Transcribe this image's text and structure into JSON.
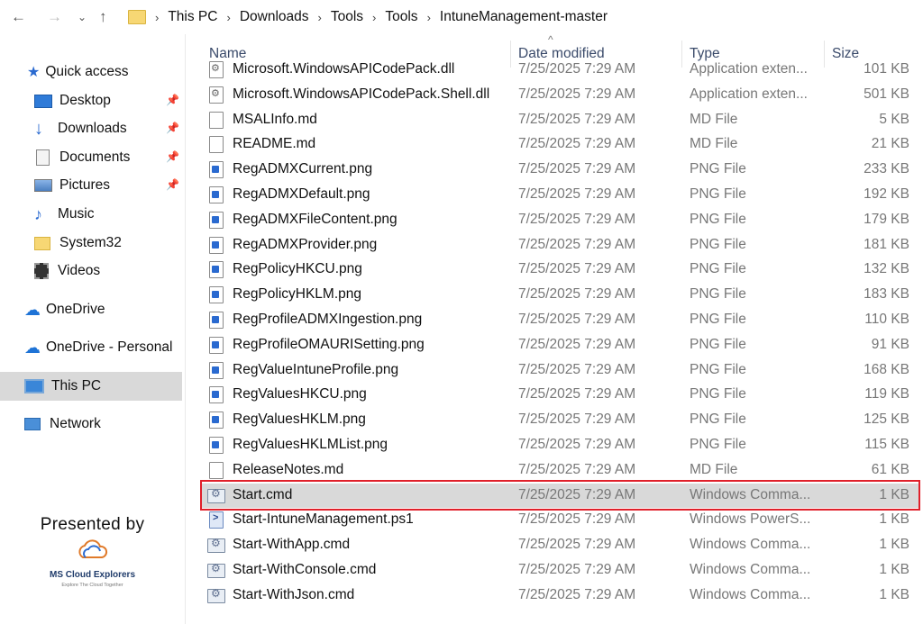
{
  "address_bar": {
    "crumbs": [
      "This PC",
      "Downloads",
      "Tools",
      "Tools",
      "IntuneManagement-master"
    ]
  },
  "sidebar": {
    "quick_access": "Quick access",
    "items": [
      {
        "label": "Desktop",
        "icon": "desktop-icon",
        "pinned": true
      },
      {
        "label": "Downloads",
        "icon": "download-arrow-icon",
        "pinned": true
      },
      {
        "label": "Documents",
        "icon": "document-icon",
        "pinned": true
      },
      {
        "label": "Pictures",
        "icon": "pictures-icon",
        "pinned": true
      },
      {
        "label": "Music",
        "icon": "music-note-icon",
        "pinned": false
      },
      {
        "label": "System32",
        "icon": "folder-icon",
        "pinned": false
      },
      {
        "label": "Videos",
        "icon": "film-icon",
        "pinned": false
      }
    ],
    "onedrive": "OneDrive",
    "onedrive_personal": "OneDrive - Personal",
    "this_pc": "This PC",
    "network": "Network"
  },
  "columns": {
    "name": "Name",
    "date": "Date modified",
    "type": "Type",
    "size": "Size"
  },
  "files": [
    {
      "name": "Microsoft.WindowsAPICodePack.dll",
      "date": "7/25/2025 7:29 AM",
      "type": "Application exten...",
      "size": "101 KB",
      "icon": "dll"
    },
    {
      "name": "Microsoft.WindowsAPICodePack.Shell.dll",
      "date": "7/25/2025 7:29 AM",
      "type": "Application exten...",
      "size": "501 KB",
      "icon": "dll"
    },
    {
      "name": "MSALInfo.md",
      "date": "7/25/2025 7:29 AM",
      "type": "MD File",
      "size": "5 KB",
      "icon": "doc"
    },
    {
      "name": "README.md",
      "date": "7/25/2025 7:29 AM",
      "type": "MD File",
      "size": "21 KB",
      "icon": "doc"
    },
    {
      "name": "RegADMXCurrent.png",
      "date": "7/25/2025 7:29 AM",
      "type": "PNG File",
      "size": "233 KB",
      "icon": "png"
    },
    {
      "name": "RegADMXDefault.png",
      "date": "7/25/2025 7:29 AM",
      "type": "PNG File",
      "size": "192 KB",
      "icon": "png"
    },
    {
      "name": "RegADMXFileContent.png",
      "date": "7/25/2025 7:29 AM",
      "type": "PNG File",
      "size": "179 KB",
      "icon": "png"
    },
    {
      "name": "RegADMXProvider.png",
      "date": "7/25/2025 7:29 AM",
      "type": "PNG File",
      "size": "181 KB",
      "icon": "png"
    },
    {
      "name": "RegPolicyHKCU.png",
      "date": "7/25/2025 7:29 AM",
      "type": "PNG File",
      "size": "132 KB",
      "icon": "png"
    },
    {
      "name": "RegPolicyHKLM.png",
      "date": "7/25/2025 7:29 AM",
      "type": "PNG File",
      "size": "183 KB",
      "icon": "png"
    },
    {
      "name": "RegProfileADMXIngestion.png",
      "date": "7/25/2025 7:29 AM",
      "type": "PNG File",
      "size": "110 KB",
      "icon": "png"
    },
    {
      "name": "RegProfileOMAURISetting.png",
      "date": "7/25/2025 7:29 AM",
      "type": "PNG File",
      "size": "91 KB",
      "icon": "png"
    },
    {
      "name": "RegValueIntuneProfile.png",
      "date": "7/25/2025 7:29 AM",
      "type": "PNG File",
      "size": "168 KB",
      "icon": "png"
    },
    {
      "name": "RegValuesHKCU.png",
      "date": "7/25/2025 7:29 AM",
      "type": "PNG File",
      "size": "119 KB",
      "icon": "png"
    },
    {
      "name": "RegValuesHKLM.png",
      "date": "7/25/2025 7:29 AM",
      "type": "PNG File",
      "size": "125 KB",
      "icon": "png"
    },
    {
      "name": "RegValuesHKLMList.png",
      "date": "7/25/2025 7:29 AM",
      "type": "PNG File",
      "size": "115 KB",
      "icon": "png"
    },
    {
      "name": "ReleaseNotes.md",
      "date": "7/25/2025 7:29 AM",
      "type": "MD File",
      "size": "61 KB",
      "icon": "doc"
    },
    {
      "name": "Start.cmd",
      "date": "7/25/2025 7:29 AM",
      "type": "Windows Comma...",
      "size": "1 KB",
      "icon": "cmd",
      "selected": true
    },
    {
      "name": "Start-IntuneManagement.ps1",
      "date": "7/25/2025 7:29 AM",
      "type": "Windows PowerS...",
      "size": "1 KB",
      "icon": "ps1"
    },
    {
      "name": "Start-WithApp.cmd",
      "date": "7/25/2025 7:29 AM",
      "type": "Windows Comma...",
      "size": "1 KB",
      "icon": "cmd"
    },
    {
      "name": "Start-WithConsole.cmd",
      "date": "7/25/2025 7:29 AM",
      "type": "Windows Comma...",
      "size": "1 KB",
      "icon": "cmd"
    },
    {
      "name": "Start-WithJson.cmd",
      "date": "7/25/2025 7:29 AM",
      "type": "Windows Comma...",
      "size": "1 KB",
      "icon": "cmd"
    }
  ],
  "branding": {
    "presented_by": "Presented by",
    "name": "MS Cloud Explorers",
    "tagline": "Explore The Cloud Together"
  },
  "colors": {
    "highlight_border": "#e0202a",
    "selected_row": "#d9d9d9",
    "accent": "#2a6ad0"
  }
}
